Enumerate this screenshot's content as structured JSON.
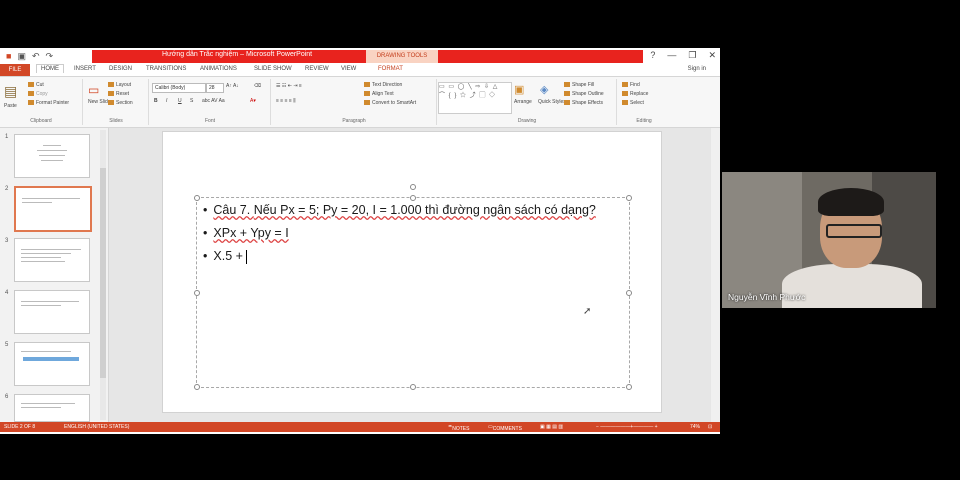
{
  "window": {
    "title": "Hướng dẫn Trắc nghiệm – Microsoft PowerPoint",
    "contextual_tab": "DRAWING TOOLS",
    "controls": [
      "?",
      "—",
      "❐",
      "✕"
    ]
  },
  "tabs": [
    "FILE",
    "HOME",
    "INSERT",
    "DESIGN",
    "TRANSITIONS",
    "ANIMATIONS",
    "SLIDE SHOW",
    "REVIEW",
    "VIEW",
    "FORMAT"
  ],
  "signin": "Sign in",
  "ribbon": {
    "clipboard": {
      "paste": "Paste",
      "cut": "Cut",
      "copy": "Copy",
      "format_painter": "Format Painter",
      "label": "Clipboard"
    },
    "slides": {
      "new_slide": "New Slide",
      "layout": "Layout",
      "reset": "Reset",
      "section": "Section",
      "label": "Slides"
    },
    "font": {
      "name": "Calibri (Body)",
      "size": "28",
      "bold": "B",
      "italic": "I",
      "underline": "U",
      "strike": "S",
      "label": "Font"
    },
    "paragraph": {
      "text_direction": "Text Direction",
      "align_text": "Align Text",
      "smartart": "Convert to SmartArt",
      "label": "Paragraph"
    },
    "drawing": {
      "arrange": "Arrange",
      "quick_styles": "Quick Styles",
      "shape_fill": "Shape Fill",
      "shape_outline": "Shape Outline",
      "shape_effects": "Shape Effects",
      "label": "Drawing"
    },
    "editing": {
      "find": "Find",
      "replace": "Replace",
      "select": "Select",
      "label": "Editing"
    }
  },
  "thumbnails": [
    "1",
    "2",
    "3",
    "4",
    "5",
    "6"
  ],
  "slide": {
    "bullets": [
      {
        "prefix": "Câu 7. ",
        "text": "Nếu Px = 5; Py = 20, I = 1.000 thì đường ngân sách có dạng?"
      },
      {
        "text": "XPx + Ypy = I"
      },
      {
        "text": "X.5 +"
      }
    ]
  },
  "status": {
    "slide": "SLIDE 2 OF 8",
    "language": "ENGLISH (UNITED STATES)",
    "notes": "NOTES",
    "comments": "COMMENTS",
    "zoom": "74%"
  },
  "participant": {
    "name": "Nguyễn Vĩnh Phước"
  }
}
